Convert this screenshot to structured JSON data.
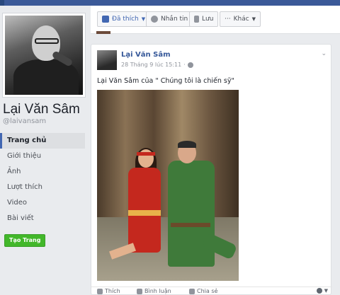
{
  "page": {
    "name": "Lại Văn Sâm",
    "handle": "@laivansam"
  },
  "nav": {
    "items": [
      {
        "label": "Trang chủ",
        "active": true
      },
      {
        "label": "Giới thiệu",
        "active": false
      },
      {
        "label": "Ảnh",
        "active": false
      },
      {
        "label": "Lượt thích",
        "active": false
      },
      {
        "label": "Video",
        "active": false
      },
      {
        "label": "Bài viết",
        "active": false
      }
    ],
    "create_page_label": "Tạo Trang"
  },
  "actionbar": {
    "liked_label": "Đã thích",
    "message_label": "Nhắn tin",
    "save_label": "Lưu",
    "more_label": "Khác"
  },
  "post": {
    "author": "Lại Văn Sâm",
    "timestamp": "28 Tháng 9 lúc 15:11",
    "text": "Lại Văn Sâm của \" Chúng tôi là chiến sỹ\"",
    "actions": {
      "like": "Thích",
      "comment": "Bình luận",
      "share": "Chia sẻ"
    }
  },
  "icons": {
    "like": "thumbs-up-icon",
    "message": "messenger-icon",
    "save": "bookmark-icon",
    "more": "ellipsis-icon",
    "globe": "globe-icon",
    "comment": "comment-icon",
    "share": "share-icon"
  },
  "colors": {
    "brand_blue": "#3b5998",
    "link_blue": "#365899",
    "create_green": "#42b72a",
    "background": "#e9ebee"
  }
}
